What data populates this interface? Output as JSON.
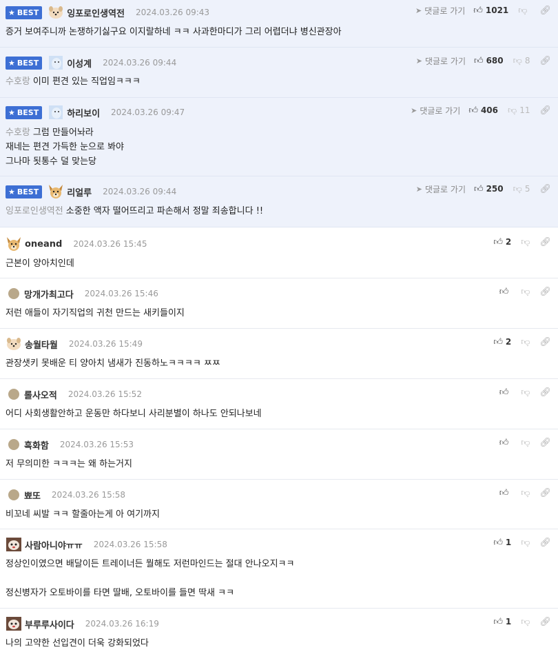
{
  "best_label": "BEST",
  "goto_label": "댓글로 가기",
  "comments": [
    {
      "nick": "잉포로인생역전",
      "date": "2024.03.26 09:43",
      "text": "증거 보여주니까 논쟁하기싫구요 이지랄하네 ㅋㅋ 사과한마디가 그리 어렵더냐 병신관장아",
      "up": "1021",
      "down": ""
    },
    {
      "nick": "이성계",
      "date": "2024.03.26 09:44",
      "reply_to": "수호랑",
      "text": "이미 편견 있는 직업임ㅋㅋㅋ",
      "up": "680",
      "down": "8"
    },
    {
      "nick": "하리보이",
      "date": "2024.03.26 09:47",
      "reply_to": "수호랑",
      "lines": [
        "그럼 만들어놔라",
        "재네는 편견 가득한 눈으로 봐야",
        "그나마 됫통수 덜 맞는당"
      ],
      "up": "406",
      "down": "11"
    },
    {
      "nick": "리얼루",
      "date": "2024.03.26 09:44",
      "reply_to": "잉포로인생역전",
      "text": "소중한 액자 떨어뜨리고 파손해서 정말 죄송합니다 !!",
      "up": "250",
      "down": "5"
    },
    {
      "nick": "oneand",
      "date": "2024.03.26 15:45",
      "text": "근본이 양아치인데",
      "up": "2"
    },
    {
      "nick": "망개가최고다",
      "date": "2024.03.26 15:46",
      "text": "저런 애들이 자기직업의 귀천 만드는 새키들이지",
      "up": ""
    },
    {
      "nick": "송월타월",
      "date": "2024.03.26 15:49",
      "text": "관장샛키 못배운 티 양아치 냄새가 진동하노ㅋㅋㅋㅋ ㅉㅉ",
      "up": "2"
    },
    {
      "nick": "롤사오적",
      "date": "2024.03.26 15:52",
      "text": "어디 사회생활안하고 운동만 하다보니 사리분별이 하나도 안되나보네",
      "up": ""
    },
    {
      "nick": "흑화함",
      "date": "2024.03.26 15:53",
      "text": "저 무의미한 ㅋㅋㅋ는 왜 하는거지",
      "up": ""
    },
    {
      "nick": "뾰또",
      "date": "2024.03.26 15:58",
      "text": "비꼬네 씨발 ㅋㅋ 할줄아는게 아 여기까지",
      "up": ""
    },
    {
      "nick": "사람아니야ㅠㅠ",
      "date": "2024.03.26 15:58",
      "lines": [
        "정상인이였으면 배달이든 트레이너든 뭘해도 저런마인드는 절대 안나오지ㅋㅋ",
        "",
        "정신병자가 오토바이를 타면 딸배, 오토바이를 들면 딱새 ㅋㅋ"
      ],
      "up": "1"
    },
    {
      "nick": "부루루사이다",
      "date": "2024.03.26 16:19",
      "text": "나의 고약한 선입견이 더욱 강화되었다",
      "up": "1"
    }
  ],
  "icons": {
    "best": "star-icon",
    "goto": "send-arrow-icon",
    "up": "thumbs-up-icon",
    "down": "thumbs-down-icon",
    "link": "link-icon"
  },
  "colors": {
    "best_bg": "#eef2fb",
    "badge": "#3d6fd4"
  }
}
